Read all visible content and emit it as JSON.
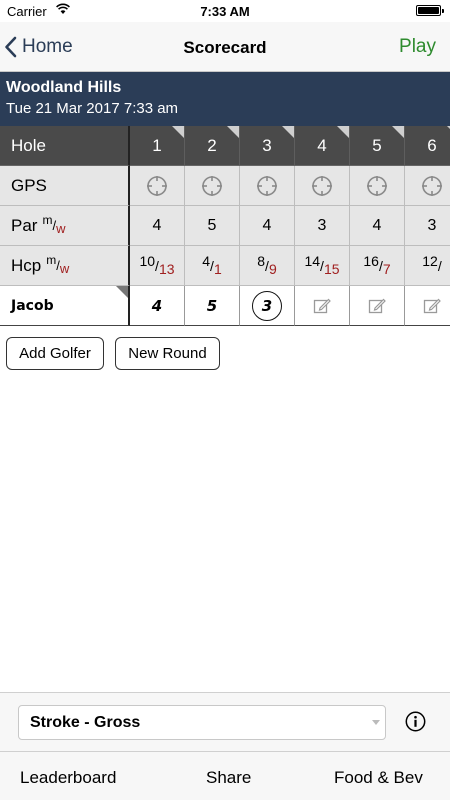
{
  "status_bar": {
    "carrier": "Carrier",
    "time": "7:33 AM"
  },
  "nav": {
    "back_label": "Home",
    "title": "Scorecard",
    "action_label": "Play"
  },
  "course": {
    "name": "Woodland Hills",
    "date": "Tue 21 Mar 2017 7:33 am"
  },
  "grid": {
    "hole_label": "Hole",
    "gps_label": "GPS",
    "par_label": "Par",
    "par_sup_m": "m",
    "par_sup_w": "w",
    "hcp_label": "Hcp",
    "hcp_sup_m": "m",
    "hcp_sup_w": "w",
    "holes": [
      "1",
      "2",
      "3",
      "4",
      "5",
      "6"
    ],
    "par": [
      "4",
      "5",
      "4",
      "3",
      "4",
      "3"
    ],
    "hcp": [
      {
        "m": "10",
        "w": "13"
      },
      {
        "m": "4",
        "w": "1"
      },
      {
        "m": "8",
        "w": "9"
      },
      {
        "m": "14",
        "w": "15"
      },
      {
        "m": "16",
        "w": "7"
      },
      {
        "m": "12",
        "w": ""
      }
    ],
    "golfer": {
      "name": "Jacob",
      "scores": [
        "4",
        "5",
        "3",
        "",
        "",
        ""
      ]
    }
  },
  "buttons": {
    "add_golfer": "Add Golfer",
    "new_round": "New Round"
  },
  "game_select": {
    "value": "Stroke - Gross"
  },
  "tabs": {
    "leaderboard": "Leaderboard",
    "share": "Share",
    "food": "Food & Bev"
  },
  "colors": {
    "nav_header": "#2b3d57",
    "play": "#2e8b2e",
    "women_value": "#a01f1f",
    "hole_row": "#4a4a4a"
  },
  "icons": [
    "back-chevron-icon",
    "wifi-icon",
    "battery-icon",
    "gps-target-icon",
    "edit-icon",
    "info-icon"
  ]
}
